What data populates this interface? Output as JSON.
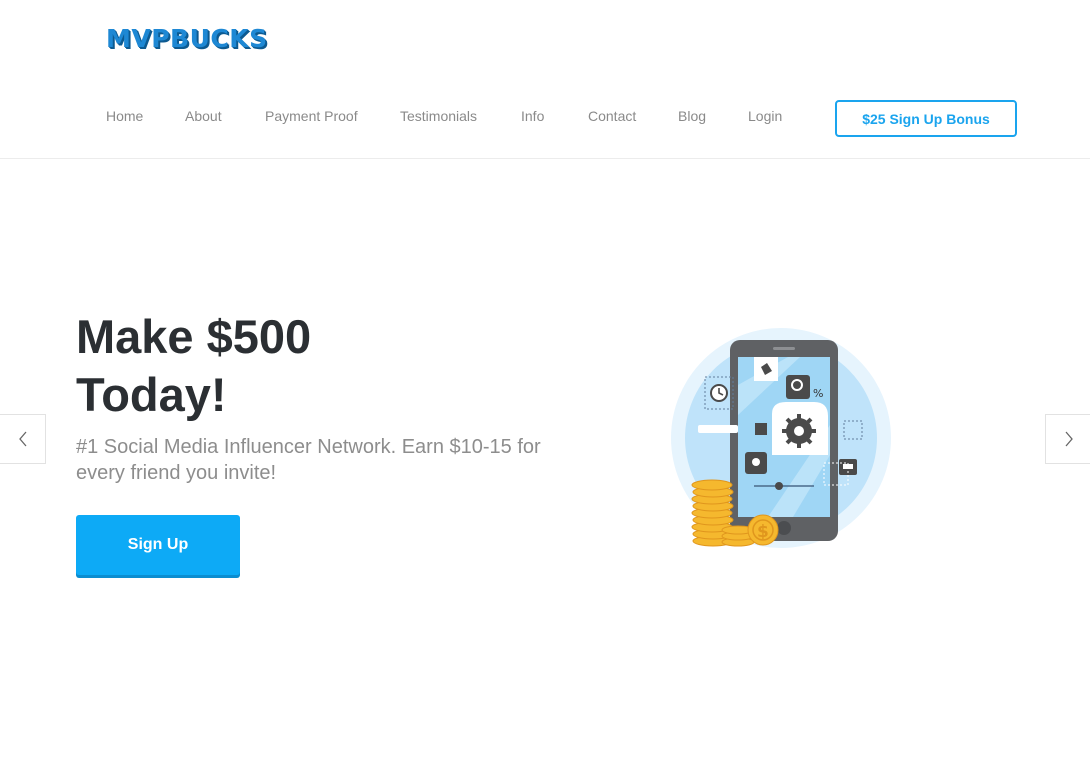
{
  "header": {
    "logo_text": "MVPBUCKS",
    "nav": [
      {
        "label": "Home"
      },
      {
        "label": "About"
      },
      {
        "label": "Payment Proof"
      },
      {
        "label": "Testimonials"
      },
      {
        "label": "Info"
      },
      {
        "label": "Contact"
      },
      {
        "label": "Blog"
      },
      {
        "label": "Login"
      }
    ],
    "signup_bonus_label": "$25 Sign Up Bonus"
  },
  "hero": {
    "title_line1": "Make $500",
    "title_line2": "Today!",
    "subtitle": "#1 Social Media Influencer Network. Earn $10-15 for every friend you invite!",
    "cta_label": "Sign Up"
  },
  "slider": {
    "prev_icon": "chevron-left-icon",
    "next_icon": "chevron-right-icon"
  },
  "colors": {
    "accent": "#0daaf6",
    "logo": "#1e88d4",
    "heading": "#2b2f33",
    "muted": "#8d8d8d",
    "coin": "#f5b82e"
  }
}
